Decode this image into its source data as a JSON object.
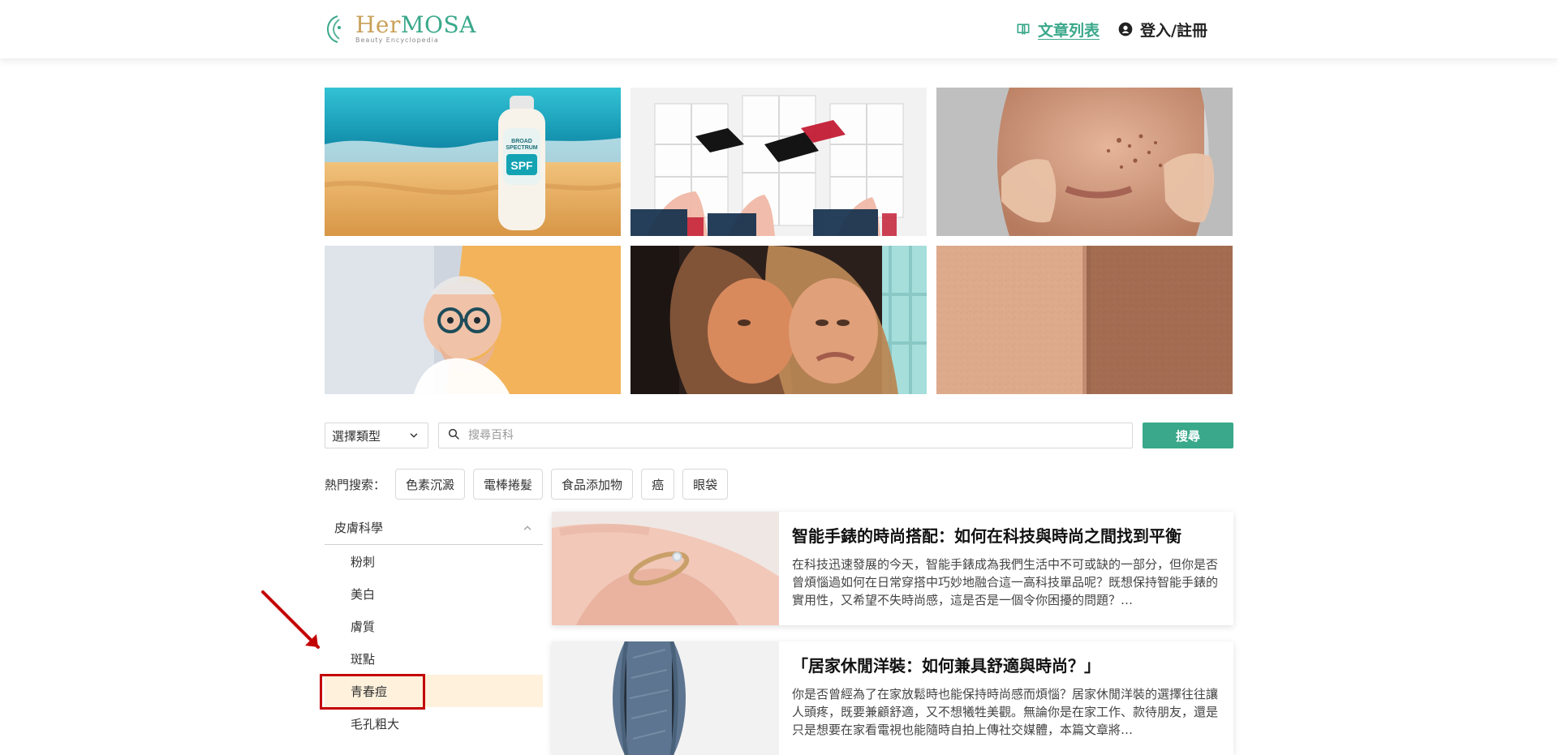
{
  "brand": {
    "name_her": "Her",
    "name_mosa": "MOSA",
    "tagline": "Beauty Encyclopedia"
  },
  "nav": {
    "articles_label": "文章列表",
    "login_label": "登入/註冊"
  },
  "top_images": [
    {
      "subject": "sunscreen-on-beach",
      "label_text": "BROAD SPECTRUM SPF"
    },
    {
      "subject": "graduation-caps-thrown"
    },
    {
      "subject": "woman-with-age-spots"
    },
    {
      "subject": "shocked-elderly-man"
    },
    {
      "subject": "two-women-close"
    },
    {
      "subject": "skin-texture-closeup"
    }
  ],
  "search": {
    "type_select_value": "選擇類型",
    "placeholder": "搜尋百科",
    "button_label": "搜尋"
  },
  "hot": {
    "label": "熱門搜索：",
    "items": [
      "色素沉澱",
      "電棒捲髮",
      "食品添加物",
      "癌",
      "眼袋"
    ]
  },
  "sidebar": {
    "category": "皮膚科學",
    "items": [
      "粉刺",
      "美白",
      "膚質",
      "斑點",
      "青春痘",
      "毛孔粗大"
    ],
    "selected_index": 4
  },
  "articles": [
    {
      "title": "智能手錶的時尚搭配：如何在科技與時尚之間找到平衡",
      "excerpt": "在科技迅速發展的今天，智能手錶成為我們生活中不可或缺的一部分，但你是否曾煩惱過如何在日常穿搭中巧妙地融合這一高科技單品呢？既想保持智能手錶的實用性，又希望不失時尚感，這是否是一個令你困擾的問題？…"
    },
    {
      "title": "「居家休閒洋裝：如何兼具舒適與時尚？」",
      "excerpt": "你是否曾經為了在家放鬆時也能保持時尚感而煩惱？居家休閒洋裝的選擇往往讓人頭疼，既要兼顧舒適，又不想犧牲美觀。無論你是在家工作、款待朋友，還是只是想要在家看電視也能隨時自拍上傳社交媒體，本篇文章將…"
    }
  ],
  "colors": {
    "accent": "#3aa88a",
    "highlight_bg": "#fff1dc",
    "annotation_red": "#c30000"
  },
  "icons": {
    "articles": "book-icon",
    "login": "user-circle-icon",
    "select_chevron": "chevron-down-icon",
    "search": "search-icon",
    "sidebar_toggle": "chevron-up-icon"
  }
}
